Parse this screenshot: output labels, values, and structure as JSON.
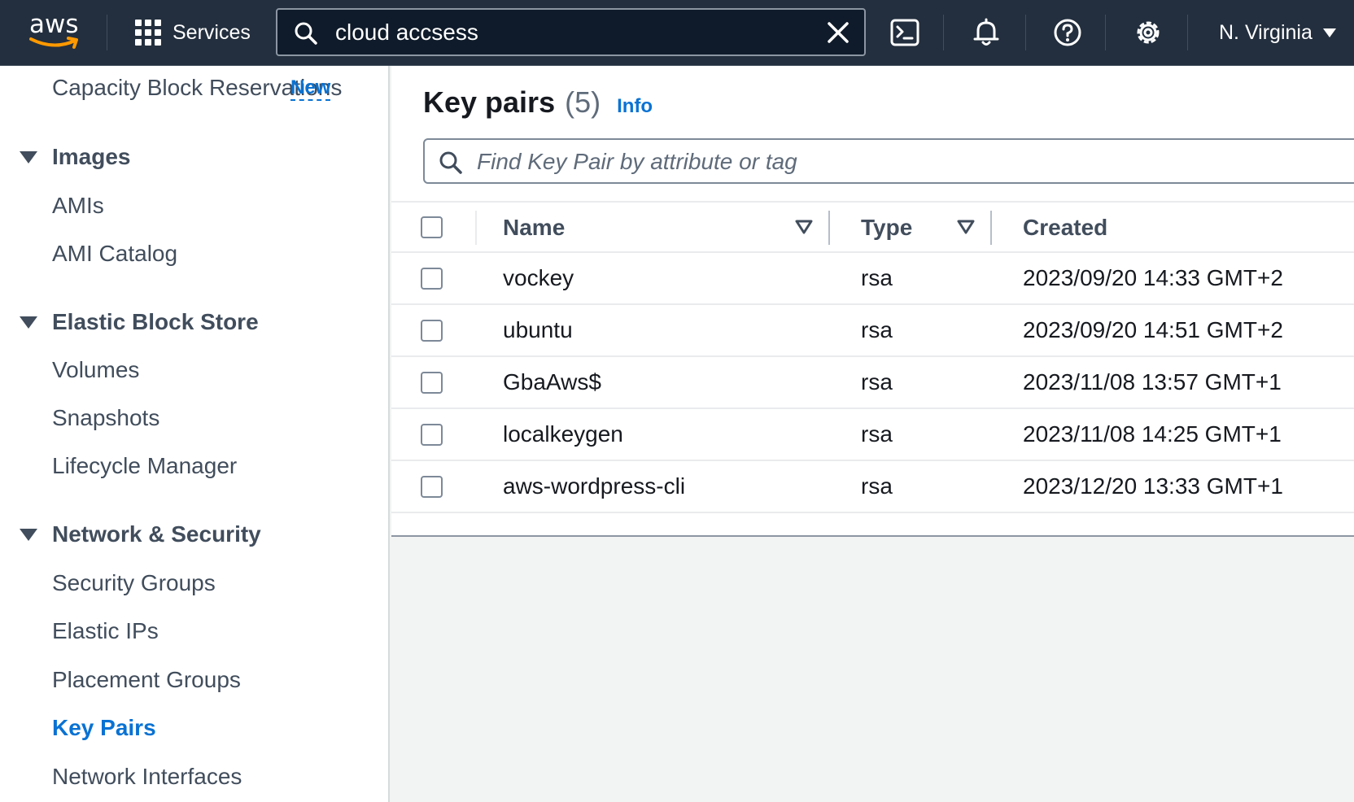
{
  "topbar": {
    "logo_text": "aws",
    "services_label": "Services",
    "search_value": "cloud accsess",
    "region_label": "N. Virginia",
    "icons": [
      "cloudshell-icon",
      "bell-icon",
      "help-icon",
      "gear-icon"
    ]
  },
  "sidebar": {
    "capacity_label": "Capacity Block Reservations",
    "capacity_badge": "New",
    "sections": [
      {
        "title": "Images",
        "items": [
          "AMIs",
          "AMI Catalog"
        ]
      },
      {
        "title": "Elastic Block Store",
        "items": [
          "Volumes",
          "Snapshots",
          "Lifecycle Manager"
        ]
      },
      {
        "title": "Network & Security",
        "items": [
          "Security Groups",
          "Elastic IPs",
          "Placement Groups",
          "Key Pairs",
          "Network Interfaces"
        ]
      }
    ],
    "active_item": "Key Pairs"
  },
  "main": {
    "title": "Key pairs",
    "count": "(5)",
    "info_label": "Info",
    "filter_placeholder": "Find Key Pair by attribute or tag",
    "columns": [
      "Name",
      "Type",
      "Created"
    ],
    "rows": [
      {
        "name": "vockey",
        "type": "rsa",
        "created": "2023/09/20 14:33 GMT+2"
      },
      {
        "name": "ubuntu",
        "type": "rsa",
        "created": "2023/09/20 14:51 GMT+2"
      },
      {
        "name": "GbaAws$",
        "type": "rsa",
        "created": "2023/11/08 13:57 GMT+1"
      },
      {
        "name": "localkeygen",
        "type": "rsa",
        "created": "2023/11/08 14:25 GMT+1"
      },
      {
        "name": "aws-wordpress-cli",
        "type": "rsa",
        "created": "2023/12/20 13:33 GMT+1"
      }
    ]
  },
  "colors": {
    "topbar_bg": "#232f3e",
    "link_blue": "#0972d3",
    "text_dark": "#16191f",
    "text_muted": "#414d5c"
  }
}
